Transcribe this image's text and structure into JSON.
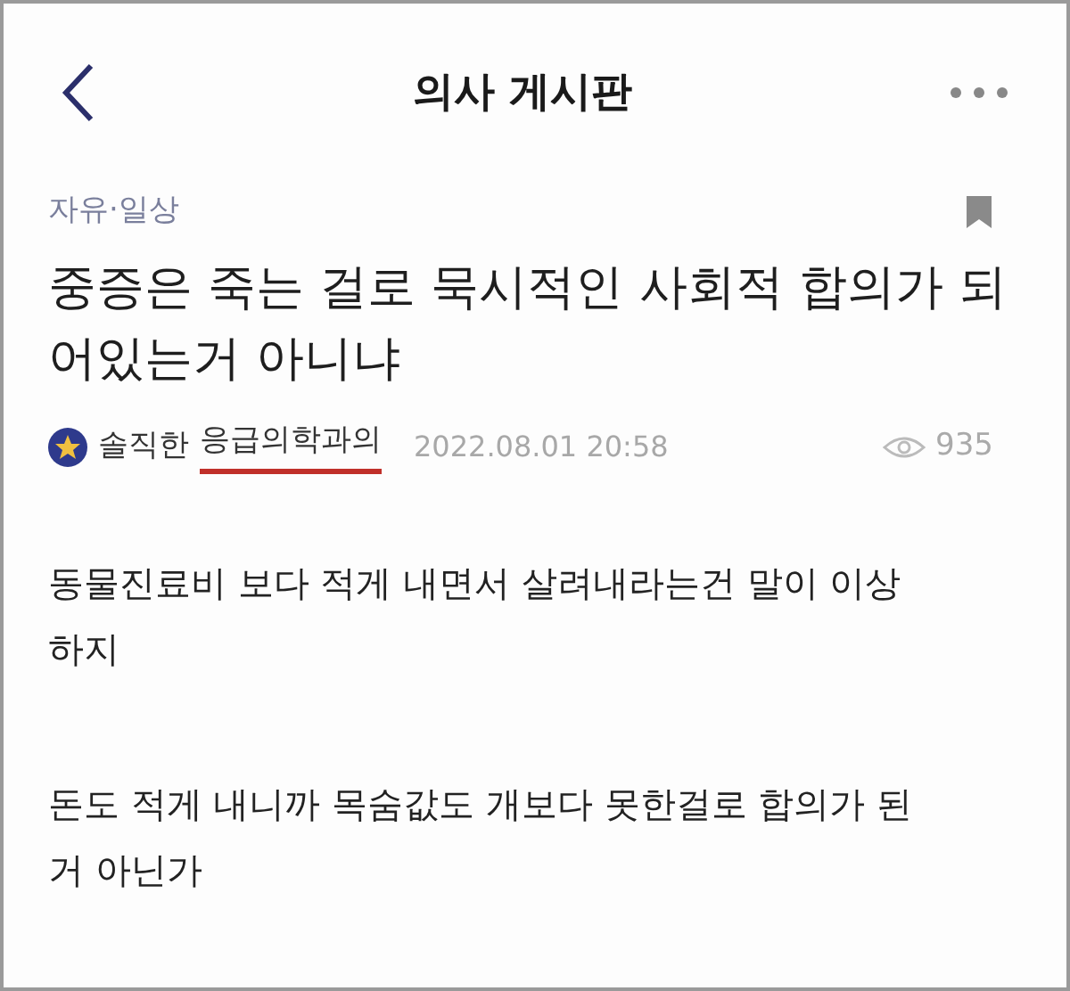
{
  "header": {
    "title": "의사 게시판"
  },
  "post": {
    "category": "자유·일상",
    "title": "중증은 죽는 걸로 묵시적인 사회적 합의가 되어있는거 아니냐",
    "author_prefix": "솔직한",
    "author_name": "응급의학과의",
    "author_name_underlined": true,
    "date": "2022.08.01 20:58",
    "views": "935",
    "paragraphs": [
      "동물진료비 보다 적게 내면서 살려내라는건 말이 이상하지",
      "돈도 적게 내니까 목숨값도 개보다 못한걸로 합의가 된거 아닌가"
    ]
  }
}
